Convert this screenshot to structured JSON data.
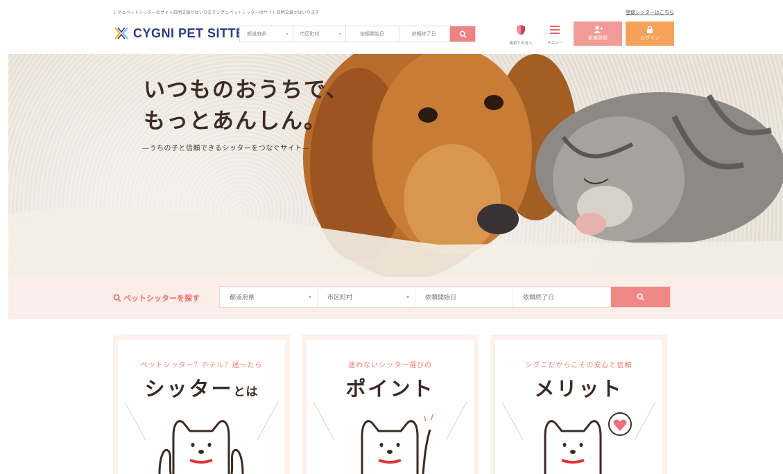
{
  "header": {
    "tagline": "シグニペットシッターのサイト説明文章がはいりますシグニペットシッターのサイト説明文章がはいります",
    "registered_link": "登録シッターはこちら",
    "logo_text": "CYGNI PET SITTER",
    "search": {
      "prefecture": "都道府県",
      "city": "市区町村",
      "start_date": "依頼開始日",
      "end_date": "依頼終了日"
    },
    "nav_first": "初めての方へ",
    "nav_menu": "メニュー",
    "register": "新規登録",
    "login": "ログイン"
  },
  "hero": {
    "title_line1": "いつものおうちで、",
    "title_line2": "もっとあんしん。",
    "subtitle": "—うちの子と信頼できるシッターをつなぐサイト—"
  },
  "search_bar": {
    "label": "ペットシッターを探す",
    "prefecture": "都道府県",
    "city": "市区町村",
    "start_date": "依頼開始日",
    "end_date": "依頼終了日"
  },
  "cards": [
    {
      "sub": "ペットシッター？ホテル？迷ったら",
      "title": "シッター",
      "title_small": "とは"
    },
    {
      "sub": "迷わないシッター選びの",
      "title": "ポイント",
      "title_small": ""
    },
    {
      "sub": "シグニだからこその安心と信頼",
      "title": "メリット",
      "title_small": ""
    }
  ],
  "colors": {
    "accent_pink": "#f08281",
    "accent_orange": "#f7a25a",
    "logo_navy": "#2d3a8c",
    "band_bg": "#fbeeea"
  },
  "icons": [
    "search-icon",
    "shield-icon",
    "hamburger-icon",
    "user-plus-icon",
    "lock-icon",
    "dog-icon",
    "heart-icon"
  ]
}
